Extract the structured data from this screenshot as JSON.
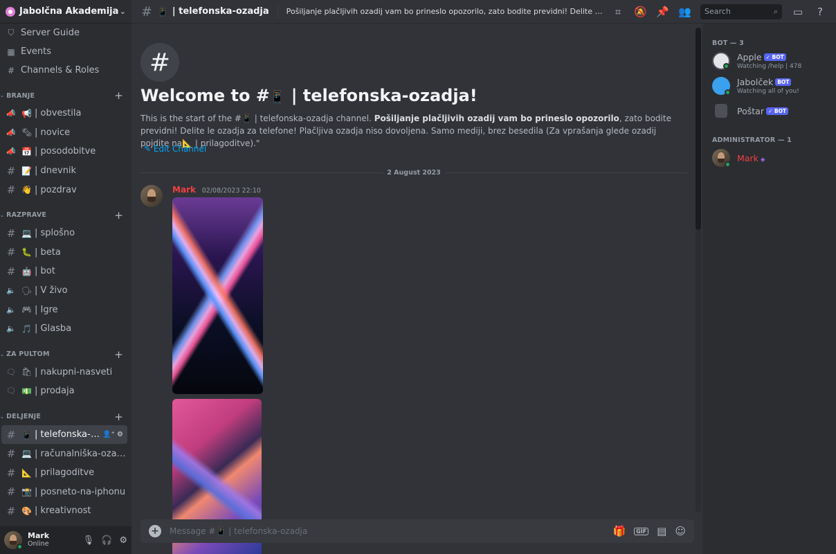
{
  "server": {
    "name": "Jabolčna Akademija"
  },
  "util_items": [
    {
      "icon": "⛉",
      "label": "Server Guide"
    },
    {
      "icon": "▦",
      "label": "Events"
    },
    {
      "icon": "#",
      "label": "Channels & Roles"
    }
  ],
  "categories": [
    {
      "label": "BRANJE",
      "channels": [
        {
          "type": "📢",
          "emoji": "📢",
          "name": "| obvestila"
        },
        {
          "type": "📢",
          "emoji": "🗞",
          "name": "| novice"
        },
        {
          "type": "📢",
          "emoji": "📅",
          "name": "| posodobitve"
        },
        {
          "type": "#",
          "emoji": "📝",
          "name": "| dnevnik"
        },
        {
          "type": "#",
          "emoji": "👋",
          "name": "| pozdrav"
        }
      ]
    },
    {
      "label": "RAZPRAVE",
      "channels": [
        {
          "type": "#",
          "emoji": "💻",
          "name": "| splošno"
        },
        {
          "type": "#",
          "emoji": "🐛",
          "name": "| beta"
        },
        {
          "type": "#",
          "emoji": "🤖",
          "name": "| bot"
        },
        {
          "type": "🔊",
          "emoji": "🗣",
          "name": "| V živo"
        },
        {
          "type": "🔊",
          "emoji": "🎮",
          "name": "| Igre"
        },
        {
          "type": "🔊",
          "emoji": "🎵",
          "name": "| Glasba"
        }
      ]
    },
    {
      "label": "ZA PULTOM",
      "channels": [
        {
          "type": "💬",
          "emoji": "🛍",
          "name": "| nakupni-nasveti"
        },
        {
          "type": "💬",
          "emoji": "💵",
          "name": "| prodaja"
        }
      ]
    },
    {
      "label": "DELJENJE",
      "channels": [
        {
          "type": "#",
          "emoji": "📱",
          "name": "| telefonska-o...",
          "active": true
        },
        {
          "type": "#",
          "emoji": "💻",
          "name": "| računalniška-ozadja"
        },
        {
          "type": "#",
          "emoji": "📐",
          "name": "| prilagoditve"
        },
        {
          "type": "#",
          "emoji": "📸",
          "name": "| posneto-na-iphonu"
        },
        {
          "type": "#",
          "emoji": "🎨",
          "name": "| kreativnost"
        }
      ]
    }
  ],
  "user": {
    "name": "Mark",
    "status": "Online"
  },
  "topbar": {
    "channel_emoji": "📱",
    "channel_name": "| telefonska-ozadja",
    "topic": "Pošiljanje plačljivih ozadij vam bo prineslo opozorilo, zato bodite previdni! Delite le ozadja za telefo...",
    "search_placeholder": "Search"
  },
  "welcome": {
    "title_prefix": "Welcome to #",
    "title_emoji": "📱",
    "title_name": "| telefonska-ozadja!",
    "desc_start": "This is the start of the #",
    "desc_emoji": "📱",
    "desc_channel": " | telefonska-ozadja channel. ",
    "desc_bold": "Pošiljanje plačljivih ozadij vam bo prineslo opozorilo",
    "desc_rest": ", zato bodite previdni! Delite le ozadja za telefone! Plačljiva ozadja niso dovoljena. Samo mediji, brez besedila (Za vprašanja glede ozadij pojdite na",
    "desc_link_emoji": "📐",
    "desc_end": " | prilagoditve).\"",
    "edit_label": "Edit Channel"
  },
  "date_divider": "2 August 2023",
  "message": {
    "author": "Mark",
    "timestamp": "02/08/2023 22:10"
  },
  "composer": {
    "placeholder": "Message #📱 | telefonska-ozadja"
  },
  "members": {
    "bot_group": "BOT — 3",
    "bots": [
      {
        "name": "Apple",
        "badge": "✓ BOT",
        "sub": "Watching /help | 478",
        "color": "#b5bac1"
      },
      {
        "name": "Jabolček",
        "badge": "BOT",
        "sub": "Watching all of you!",
        "color": "#b5bac1"
      },
      {
        "name": "Poštar",
        "badge": "✓ BOT",
        "sub": "",
        "color": "#b5bac1"
      }
    ],
    "admin_group": "ADMINISTRATOR — 1",
    "admins": [
      {
        "name": "Mark",
        "color": "#f23f43"
      }
    ]
  },
  "colors": {
    "accent": "#5865f2",
    "online": "#23a55a",
    "admin": "#f23f43",
    "link": "#00a8fc"
  }
}
